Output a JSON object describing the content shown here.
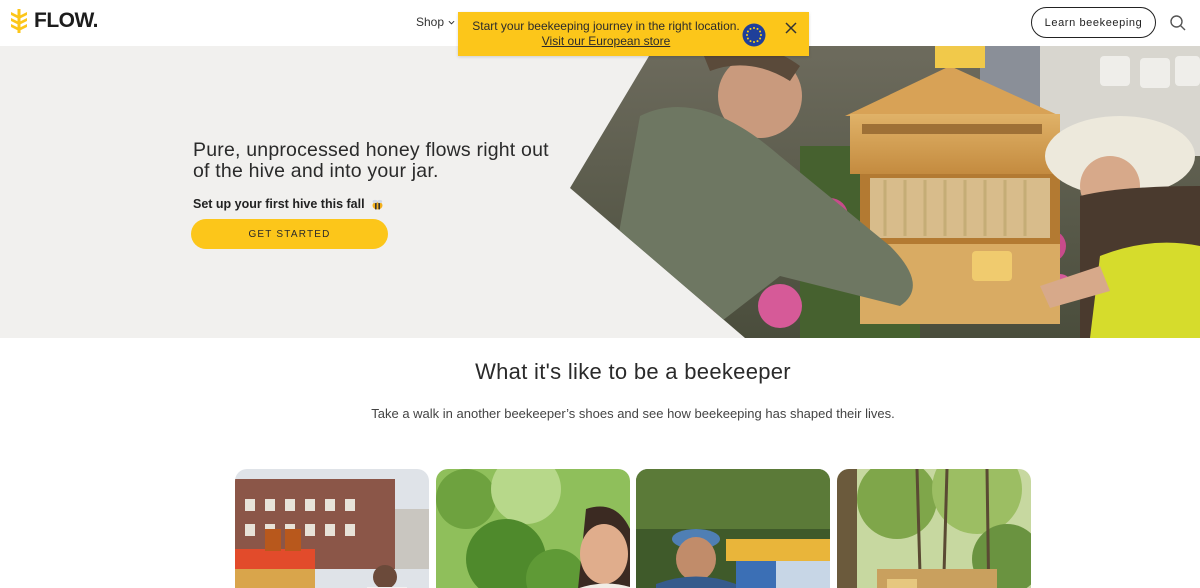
{
  "header": {
    "brand": "FLOW.",
    "nav": {
      "shop_label": "Shop"
    },
    "learn_label": "Learn beekeeping",
    "search_icon": "search-icon"
  },
  "banner": {
    "message": "Start your beekeeping journey in the right location.",
    "link_label": "Visit our European store",
    "flag_icon": "eu-flag-icon",
    "close_icon": "close-icon",
    "background": "#fcc61a"
  },
  "hero": {
    "title": "Pure, unprocessed honey flows right out of the hive and into your jar.",
    "subtitle": "Set up your first hive this fall",
    "cta_label": "GET STARTED",
    "accent": "#fcc61a"
  },
  "beekeepers": {
    "title": "What it's like to be a beekeeper",
    "subtitle": "Take a walk in another beekeeper’s shoes and see how beekeeping has shaped their lives.",
    "cards": [
      {
        "image": "rooftop-city-beekeeper"
      },
      {
        "image": "garden-beekeeper-woman"
      },
      {
        "image": "smiling-beekeeper-with-hives"
      },
      {
        "image": "forest-hive-stand"
      }
    ]
  }
}
